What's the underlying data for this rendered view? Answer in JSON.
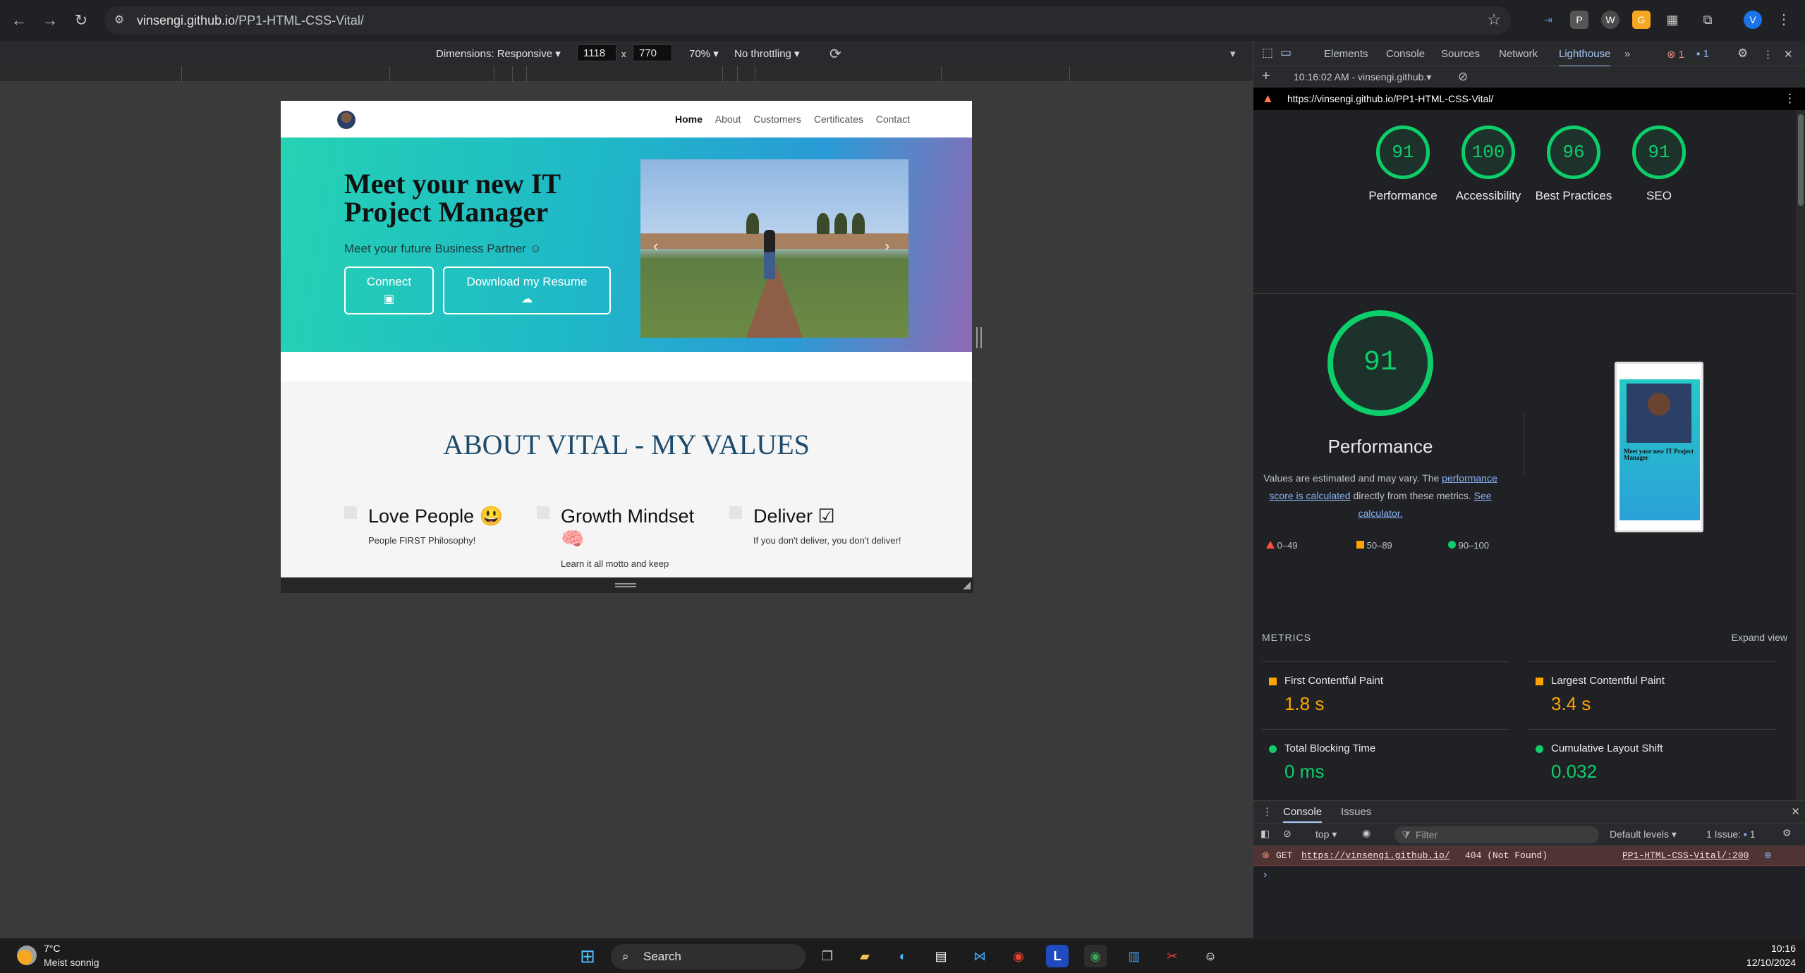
{
  "browser": {
    "url_host": "vinsengi.github.io",
    "url_path": "/PP1-HTML-CSS-Vital/",
    "profile_initial": "V"
  },
  "device_toolbar": {
    "dimensions_label": "Dimensions: Responsive",
    "width_value": "1118",
    "times": "x",
    "height_value": "770",
    "zoom": "70%",
    "throttling": "No throttling"
  },
  "site": {
    "nav": [
      "Home",
      "About",
      "Customers",
      "Certificates",
      "Contact"
    ],
    "hero_title": "Meet your new IT Project Manager",
    "hero_subtitle": "Meet your future Business Partner ☺",
    "connect_label": "Connect",
    "download_label": "Download my Resume",
    "about_title": "ABOUT VITAL - MY VALUES",
    "values": [
      {
        "title": "Love People 😃",
        "text": "People FIRST Philosophy!"
      },
      {
        "title": "Growth Mindset 🧠",
        "text": "Learn it all motto and keep"
      },
      {
        "title": "Deliver ☑",
        "text": "If you don't deliver, you don't deliver!"
      }
    ]
  },
  "devtools": {
    "tabs": [
      "Elements",
      "Console",
      "Sources",
      "Network",
      "Lighthouse"
    ],
    "selected_tab": "Lighthouse",
    "more": "»",
    "error_count": "1",
    "issue_count": "1",
    "report_label": "10:16:02 AM - vinsengi.github.▾",
    "report_url": "https://vinsengi.github.io/PP1-HTML-CSS-Vital/",
    "scores": [
      {
        "value": "91",
        "label": "Performance"
      },
      {
        "value": "100",
        "label": "Accessibility"
      },
      {
        "value": "96",
        "label": "Best Practices"
      },
      {
        "value": "91",
        "label": "SEO"
      }
    ],
    "perf_score": "91",
    "perf_title": "Performance",
    "note_1": "Values are estimated and may vary. The",
    "note_link_1": "performance score is calculated",
    "note_2": "directly from these metrics.",
    "note_link_2": "See calculator.",
    "legend": [
      "0–49",
      "50–89",
      "90–100"
    ],
    "thumbnail_title": "Meet your new IT Project Manager",
    "metrics_header": "METRICS",
    "expand_view": "Expand view",
    "metrics": [
      {
        "name": "First Contentful Paint",
        "value": "1.8 s",
        "status": "average"
      },
      {
        "name": "Largest Contentful Paint",
        "value": "3.4 s",
        "status": "average"
      },
      {
        "name": "Total Blocking Time",
        "value": "0 ms",
        "status": "pass"
      },
      {
        "name": "Cumulative Layout Shift",
        "value": "0.032",
        "status": "pass"
      }
    ],
    "colors": {
      "pass": "#0cce6b",
      "average": "#ffa400",
      "fail": "#ff4e42"
    }
  },
  "console": {
    "tabs": [
      "Console",
      "Issues"
    ],
    "context": "top ▾",
    "filter_placeholder": "Filter",
    "levels": "Default levels ▾",
    "issues": "1 Issue:",
    "issues_count": "1",
    "error_method": "GET",
    "error_url": "https://vinsengi.github.io/",
    "error_status": "404 (Not Found)",
    "error_source": "PP1-HTML-CSS-Vital/:200",
    "prompt": "›"
  },
  "taskbar": {
    "weather_temp": "7°C",
    "weather_desc": "Meist sonnig",
    "search_label": "Search",
    "time": "10:16",
    "date": "12/10/2024"
  }
}
